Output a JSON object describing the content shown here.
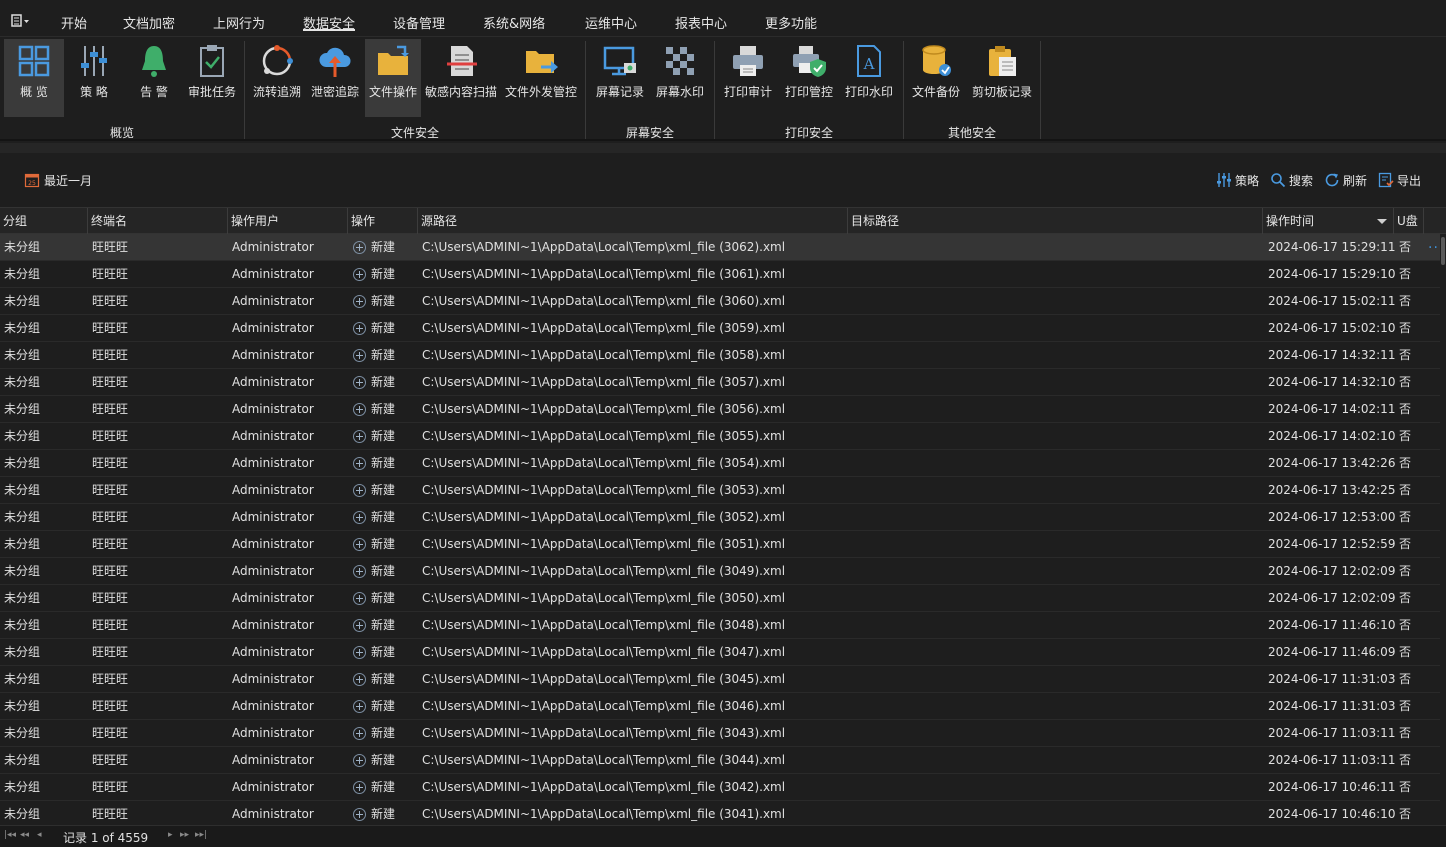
{
  "menubar": {
    "app_menu_icon": "list-menu-icon",
    "tabs": [
      {
        "label": "开始"
      },
      {
        "label": "文档加密"
      },
      {
        "label": "上网行为"
      },
      {
        "label": "数据安全",
        "active": true
      },
      {
        "label": "设备管理"
      },
      {
        "label": "系统&网络"
      },
      {
        "label": "运维中心"
      },
      {
        "label": "报表中心"
      },
      {
        "label": "更多功能"
      }
    ]
  },
  "ribbon": {
    "buttons": [
      {
        "label": "概 览",
        "icon": "grid-overview-icon"
      },
      {
        "label": "策 略",
        "icon": "policy-sliders-icon"
      },
      {
        "label": "告 警",
        "icon": "bell-alert-icon"
      },
      {
        "label": "审批任务",
        "icon": "approval-clipboard-icon"
      },
      {
        "label": "流转追溯",
        "icon": "flow-trace-icon"
      },
      {
        "label": "泄密追踪",
        "icon": "cloud-upload-icon"
      },
      {
        "label": "文件操作",
        "icon": "folder-operation-icon",
        "selected": true
      },
      {
        "label": "敏感内容扫描",
        "icon": "document-scan-icon"
      },
      {
        "label": "文件外发管控",
        "icon": "folder-send-icon"
      },
      {
        "label": "屏幕记录",
        "icon": "monitor-record-icon"
      },
      {
        "label": "屏幕水印",
        "icon": "checker-watermark-icon"
      },
      {
        "label": "打印审计",
        "icon": "printer-icon"
      },
      {
        "label": "打印管控",
        "icon": "printer-shield-icon"
      },
      {
        "label": "打印水印",
        "icon": "document-letter-icon"
      },
      {
        "label": "文件备份",
        "icon": "database-backup-icon"
      },
      {
        "label": "剪切板记录",
        "icon": "clipboard-icon"
      }
    ],
    "groups": [
      "概览",
      "文件安全",
      "屏幕安全",
      "打印安全",
      "其他安全"
    ]
  },
  "toolbar": {
    "date_filter": "最近一月",
    "date_icon": "calendar-icon",
    "actions": [
      {
        "label": "策略",
        "icon": "policy-sliders-icon"
      },
      {
        "label": "搜索",
        "icon": "search-icon"
      },
      {
        "label": "刷新",
        "icon": "refresh-icon"
      },
      {
        "label": "导出",
        "icon": "export-icon"
      }
    ]
  },
  "grid": {
    "columns": [
      "分组",
      "终端名",
      "操作用户",
      "操作",
      "源路径",
      "目标路径",
      "操作时间",
      "U盘"
    ],
    "rows": [
      {
        "group": "未分组",
        "terminal": "旺旺旺",
        "user": "Administrator",
        "op": "新建",
        "src": "C:\\Users\\ADMINI~1\\AppData\\Local\\Temp\\xml_file (3062).xml",
        "dst": "",
        "time": "2024-06-17 15:29:11",
        "usb": "否"
      },
      {
        "group": "未分组",
        "terminal": "旺旺旺",
        "user": "Administrator",
        "op": "新建",
        "src": "C:\\Users\\ADMINI~1\\AppData\\Local\\Temp\\xml_file (3061).xml",
        "dst": "",
        "time": "2024-06-17 15:29:10",
        "usb": "否"
      },
      {
        "group": "未分组",
        "terminal": "旺旺旺",
        "user": "Administrator",
        "op": "新建",
        "src": "C:\\Users\\ADMINI~1\\AppData\\Local\\Temp\\xml_file (3060).xml",
        "dst": "",
        "time": "2024-06-17 15:02:11",
        "usb": "否"
      },
      {
        "group": "未分组",
        "terminal": "旺旺旺",
        "user": "Administrator",
        "op": "新建",
        "src": "C:\\Users\\ADMINI~1\\AppData\\Local\\Temp\\xml_file (3059).xml",
        "dst": "",
        "time": "2024-06-17 15:02:10",
        "usb": "否"
      },
      {
        "group": "未分组",
        "terminal": "旺旺旺",
        "user": "Administrator",
        "op": "新建",
        "src": "C:\\Users\\ADMINI~1\\AppData\\Local\\Temp\\xml_file (3058).xml",
        "dst": "",
        "time": "2024-06-17 14:32:11",
        "usb": "否"
      },
      {
        "group": "未分组",
        "terminal": "旺旺旺",
        "user": "Administrator",
        "op": "新建",
        "src": "C:\\Users\\ADMINI~1\\AppData\\Local\\Temp\\xml_file (3057).xml",
        "dst": "",
        "time": "2024-06-17 14:32:10",
        "usb": "否"
      },
      {
        "group": "未分组",
        "terminal": "旺旺旺",
        "user": "Administrator",
        "op": "新建",
        "src": "C:\\Users\\ADMINI~1\\AppData\\Local\\Temp\\xml_file (3056).xml",
        "dst": "",
        "time": "2024-06-17 14:02:11",
        "usb": "否"
      },
      {
        "group": "未分组",
        "terminal": "旺旺旺",
        "user": "Administrator",
        "op": "新建",
        "src": "C:\\Users\\ADMINI~1\\AppData\\Local\\Temp\\xml_file (3055).xml",
        "dst": "",
        "time": "2024-06-17 14:02:10",
        "usb": "否"
      },
      {
        "group": "未分组",
        "terminal": "旺旺旺",
        "user": "Administrator",
        "op": "新建",
        "src": "C:\\Users\\ADMINI~1\\AppData\\Local\\Temp\\xml_file (3054).xml",
        "dst": "",
        "time": "2024-06-17 13:42:26",
        "usb": "否"
      },
      {
        "group": "未分组",
        "terminal": "旺旺旺",
        "user": "Administrator",
        "op": "新建",
        "src": "C:\\Users\\ADMINI~1\\AppData\\Local\\Temp\\xml_file (3053).xml",
        "dst": "",
        "time": "2024-06-17 13:42:25",
        "usb": "否"
      },
      {
        "group": "未分组",
        "terminal": "旺旺旺",
        "user": "Administrator",
        "op": "新建",
        "src": "C:\\Users\\ADMINI~1\\AppData\\Local\\Temp\\xml_file (3052).xml",
        "dst": "",
        "time": "2024-06-17 12:53:00",
        "usb": "否"
      },
      {
        "group": "未分组",
        "terminal": "旺旺旺",
        "user": "Administrator",
        "op": "新建",
        "src": "C:\\Users\\ADMINI~1\\AppData\\Local\\Temp\\xml_file (3051).xml",
        "dst": "",
        "time": "2024-06-17 12:52:59",
        "usb": "否"
      },
      {
        "group": "未分组",
        "terminal": "旺旺旺",
        "user": "Administrator",
        "op": "新建",
        "src": "C:\\Users\\ADMINI~1\\AppData\\Local\\Temp\\xml_file (3049).xml",
        "dst": "",
        "time": "2024-06-17 12:02:09",
        "usb": "否"
      },
      {
        "group": "未分组",
        "terminal": "旺旺旺",
        "user": "Administrator",
        "op": "新建",
        "src": "C:\\Users\\ADMINI~1\\AppData\\Local\\Temp\\xml_file (3050).xml",
        "dst": "",
        "time": "2024-06-17 12:02:09",
        "usb": "否"
      },
      {
        "group": "未分组",
        "terminal": "旺旺旺",
        "user": "Administrator",
        "op": "新建",
        "src": "C:\\Users\\ADMINI~1\\AppData\\Local\\Temp\\xml_file (3048).xml",
        "dst": "",
        "time": "2024-06-17 11:46:10",
        "usb": "否"
      },
      {
        "group": "未分组",
        "terminal": "旺旺旺",
        "user": "Administrator",
        "op": "新建",
        "src": "C:\\Users\\ADMINI~1\\AppData\\Local\\Temp\\xml_file (3047).xml",
        "dst": "",
        "time": "2024-06-17 11:46:09",
        "usb": "否"
      },
      {
        "group": "未分组",
        "terminal": "旺旺旺",
        "user": "Administrator",
        "op": "新建",
        "src": "C:\\Users\\ADMINI~1\\AppData\\Local\\Temp\\xml_file (3045).xml",
        "dst": "",
        "time": "2024-06-17 11:31:03",
        "usb": "否"
      },
      {
        "group": "未分组",
        "terminal": "旺旺旺",
        "user": "Administrator",
        "op": "新建",
        "src": "C:\\Users\\ADMINI~1\\AppData\\Local\\Temp\\xml_file (3046).xml",
        "dst": "",
        "time": "2024-06-17 11:31:03",
        "usb": "否"
      },
      {
        "group": "未分组",
        "terminal": "旺旺旺",
        "user": "Administrator",
        "op": "新建",
        "src": "C:\\Users\\ADMINI~1\\AppData\\Local\\Temp\\xml_file (3043).xml",
        "dst": "",
        "time": "2024-06-17 11:03:11",
        "usb": "否"
      },
      {
        "group": "未分组",
        "terminal": "旺旺旺",
        "user": "Administrator",
        "op": "新建",
        "src": "C:\\Users\\ADMINI~1\\AppData\\Local\\Temp\\xml_file (3044).xml",
        "dst": "",
        "time": "2024-06-17 11:03:11",
        "usb": "否"
      },
      {
        "group": "未分组",
        "terminal": "旺旺旺",
        "user": "Administrator",
        "op": "新建",
        "src": "C:\\Users\\ADMINI~1\\AppData\\Local\\Temp\\xml_file (3042).xml",
        "dst": "",
        "time": "2024-06-17 10:46:11",
        "usb": "否"
      },
      {
        "group": "未分组",
        "terminal": "旺旺旺",
        "user": "Administrator",
        "op": "新建",
        "src": "C:\\Users\\ADMINI~1\\AppData\\Local\\Temp\\xml_file (3041).xml",
        "dst": "",
        "time": "2024-06-17 10:46:10",
        "usb": "否"
      }
    ],
    "row_more": "···"
  },
  "pager": {
    "text": "记录 1 of 4559"
  },
  "colors": {
    "background": "#1e1e1e",
    "accent_blue": "#3d8fd6",
    "selected_row": "#353535"
  }
}
